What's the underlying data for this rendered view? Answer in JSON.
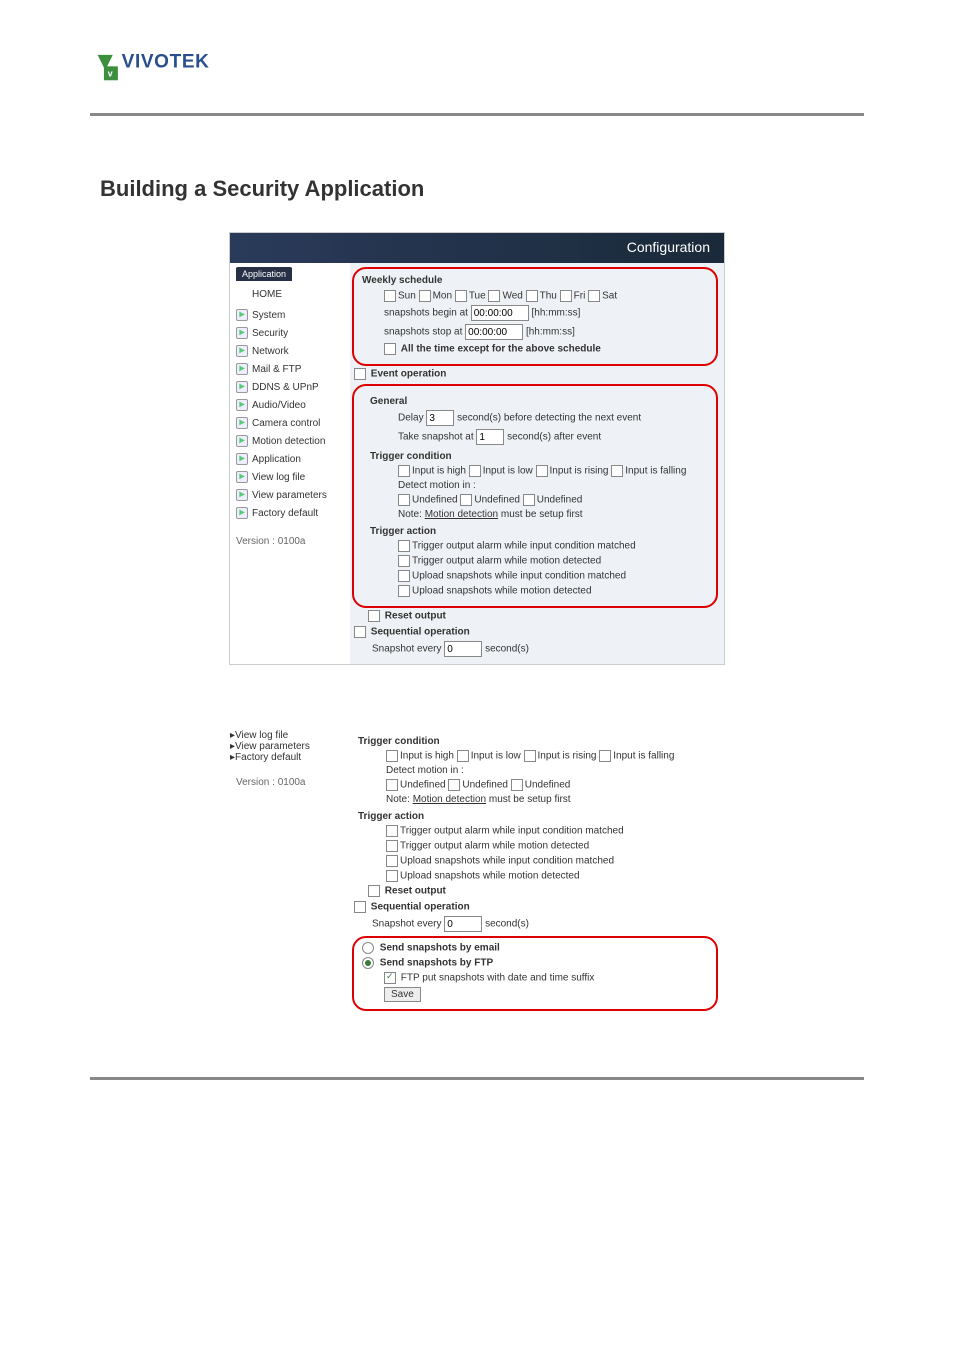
{
  "heading": "Building a Security Application",
  "config_header": "Configuration",
  "section_tab": "Application",
  "sidebar": {
    "home": "HOME",
    "items": [
      "System",
      "Security",
      "Network",
      "Mail & FTP",
      "DDNS & UPnP",
      "Audio/Video",
      "Camera control",
      "Motion detection",
      "Application",
      "View log file",
      "View parameters",
      "Factory default"
    ],
    "version": "Version : 0100a"
  },
  "weekly": {
    "title": "Weekly schedule",
    "days": [
      "Sun",
      "Mon",
      "Tue",
      "Wed",
      "Thu",
      "Fri",
      "Sat"
    ],
    "begin_label": "snapshots begin at",
    "begin_value": "00:00:00",
    "stop_label": "snapshots stop at",
    "stop_value": "00:00:00",
    "hms": "[hh:mm:ss]",
    "except_label": "All the time except for the above schedule"
  },
  "event": {
    "title": "Event operation",
    "general": "General",
    "delay_label": "Delay",
    "delay_value": "3",
    "delay_suffix": "second(s) before detecting the next event",
    "snap_label": "Take snapshot at",
    "snap_value": "1",
    "snap_suffix": "second(s) after event",
    "trigger_cond": "Trigger condition",
    "inputs": [
      "Input is high",
      "Input is low",
      "Input is rising",
      "Input is falling"
    ],
    "detect": "Detect motion in :",
    "undef": [
      "Undefined",
      "Undefined",
      "Undefined"
    ],
    "note_prefix": "Note:",
    "note_link": "Motion detection",
    "note_suffix": "must be setup first",
    "trigger_action": "Trigger action",
    "actions": [
      "Trigger output alarm while input condition matched",
      "Trigger output alarm while motion detected",
      "Upload snapshots while input condition matched",
      "Upload snapshots while motion detected"
    ],
    "reset": "Reset output"
  },
  "seq": {
    "title": "Sequential operation",
    "snapshot_label": "Snapshot every",
    "snapshot_value": "0",
    "snapshot_suffix": "second(s)"
  },
  "send": {
    "email": "Send snapshots by email",
    "ftp": "Send snapshots by FTP",
    "suffix": "FTP put snapshots with date and time suffix",
    "save": "Save"
  },
  "sidebar2_items": [
    "View log file",
    "View parameters",
    "Factory default"
  ]
}
